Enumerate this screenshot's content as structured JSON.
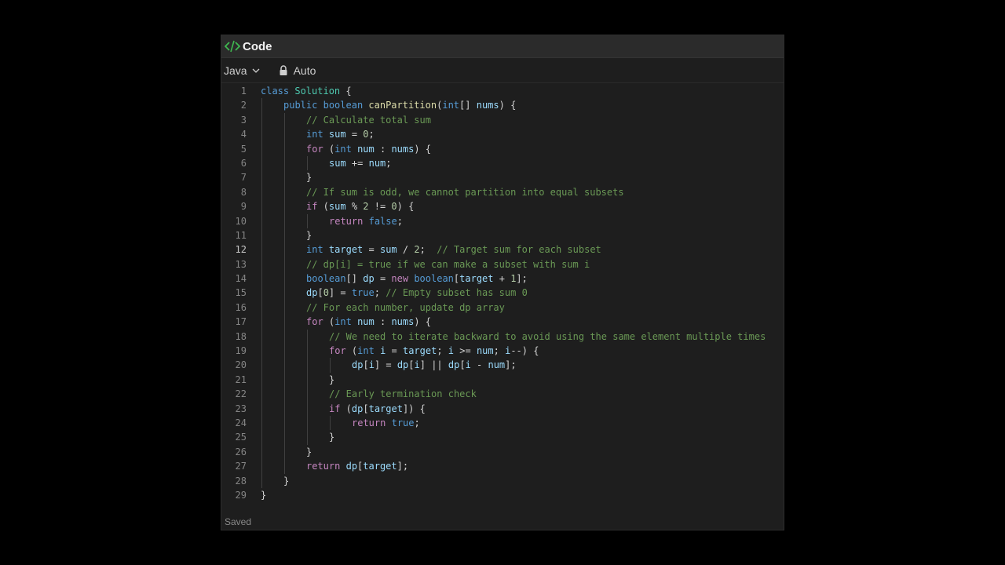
{
  "header": {
    "title": "Code",
    "icon": "code-icon",
    "accent": "#3fb950"
  },
  "toolbar": {
    "language": "Java",
    "mode": "Auto"
  },
  "status": {
    "text": "Saved"
  },
  "active_line": 12,
  "code_lines": [
    {
      "n": "1",
      "indent": 0,
      "tokens": [
        [
          "kw",
          "class"
        ],
        [
          "p",
          " "
        ],
        [
          "ty",
          "Solution"
        ],
        [
          "p",
          " {"
        ]
      ]
    },
    {
      "n": "2",
      "indent": 1,
      "tokens": [
        [
          "kw",
          "public"
        ],
        [
          "p",
          " "
        ],
        [
          "kw",
          "boolean"
        ],
        [
          "p",
          " "
        ],
        [
          "fn",
          "canPartition"
        ],
        [
          "p",
          "("
        ],
        [
          "kw",
          "int"
        ],
        [
          "p",
          "[] "
        ],
        [
          "var",
          "nums"
        ],
        [
          "p",
          ") {"
        ]
      ]
    },
    {
      "n": "3",
      "indent": 2,
      "tokens": [
        [
          "cm",
          "// Calculate total sum"
        ]
      ]
    },
    {
      "n": "4",
      "indent": 2,
      "tokens": [
        [
          "kw",
          "int"
        ],
        [
          "p",
          " "
        ],
        [
          "var",
          "sum"
        ],
        [
          "p",
          " = "
        ],
        [
          "num",
          "0"
        ],
        [
          "p",
          ";"
        ]
      ]
    },
    {
      "n": "5",
      "indent": 2,
      "tokens": [
        [
          "ctl",
          "for"
        ],
        [
          "p",
          " ("
        ],
        [
          "kw",
          "int"
        ],
        [
          "p",
          " "
        ],
        [
          "var",
          "num"
        ],
        [
          "p",
          " : "
        ],
        [
          "var",
          "nums"
        ],
        [
          "p",
          ") {"
        ]
      ]
    },
    {
      "n": "6",
      "indent": 3,
      "tokens": [
        [
          "var",
          "sum"
        ],
        [
          "p",
          " += "
        ],
        [
          "var",
          "num"
        ],
        [
          "p",
          ";"
        ]
      ]
    },
    {
      "n": "7",
      "indent": 2,
      "tokens": [
        [
          "p",
          "}"
        ]
      ]
    },
    {
      "n": "8",
      "indent": 2,
      "tokens": [
        [
          "cm",
          "// If sum is odd, we cannot partition into equal subsets"
        ]
      ]
    },
    {
      "n": "9",
      "indent": 2,
      "tokens": [
        [
          "ctl",
          "if"
        ],
        [
          "p",
          " ("
        ],
        [
          "var",
          "sum"
        ],
        [
          "p",
          " % "
        ],
        [
          "num",
          "2"
        ],
        [
          "p",
          " != "
        ],
        [
          "num",
          "0"
        ],
        [
          "p",
          ") {"
        ]
      ]
    },
    {
      "n": "10",
      "indent": 3,
      "tokens": [
        [
          "ctl",
          "return"
        ],
        [
          "p",
          " "
        ],
        [
          "kw",
          "false"
        ],
        [
          "p",
          ";"
        ]
      ]
    },
    {
      "n": "11",
      "indent": 2,
      "tokens": [
        [
          "p",
          "}"
        ]
      ]
    },
    {
      "n": "12",
      "indent": 2,
      "tokens": [
        [
          "kw",
          "int"
        ],
        [
          "p",
          " "
        ],
        [
          "var",
          "target"
        ],
        [
          "p",
          " = "
        ],
        [
          "var",
          "sum"
        ],
        [
          "p",
          " / "
        ],
        [
          "num",
          "2"
        ],
        [
          "p",
          ";  "
        ],
        [
          "cm",
          "// Target sum for each subset"
        ]
      ]
    },
    {
      "n": "13",
      "indent": 2,
      "tokens": [
        [
          "cm",
          "// dp[i] = true if we can make a subset with sum i"
        ]
      ]
    },
    {
      "n": "14",
      "indent": 2,
      "tokens": [
        [
          "kw",
          "boolean"
        ],
        [
          "p",
          "[] "
        ],
        [
          "var",
          "dp"
        ],
        [
          "p",
          " = "
        ],
        [
          "ctl",
          "new"
        ],
        [
          "p",
          " "
        ],
        [
          "kw",
          "boolean"
        ],
        [
          "p",
          "["
        ],
        [
          "var",
          "target"
        ],
        [
          "p",
          " + "
        ],
        [
          "num",
          "1"
        ],
        [
          "p",
          "];"
        ]
      ]
    },
    {
      "n": "15",
      "indent": 2,
      "tokens": [
        [
          "var",
          "dp"
        ],
        [
          "p",
          "["
        ],
        [
          "num",
          "0"
        ],
        [
          "p",
          "] = "
        ],
        [
          "kw",
          "true"
        ],
        [
          "p",
          "; "
        ],
        [
          "cm",
          "// Empty subset has sum 0"
        ]
      ]
    },
    {
      "n": "16",
      "indent": 2,
      "tokens": [
        [
          "cm",
          "// For each number, update dp array"
        ]
      ]
    },
    {
      "n": "17",
      "indent": 2,
      "tokens": [
        [
          "ctl",
          "for"
        ],
        [
          "p",
          " ("
        ],
        [
          "kw",
          "int"
        ],
        [
          "p",
          " "
        ],
        [
          "var",
          "num"
        ],
        [
          "p",
          " : "
        ],
        [
          "var",
          "nums"
        ],
        [
          "p",
          ") {"
        ]
      ]
    },
    {
      "n": "18",
      "indent": 3,
      "tokens": [
        [
          "cm",
          "// We need to iterate backward to avoid using the same element multiple times"
        ]
      ]
    },
    {
      "n": "19",
      "indent": 3,
      "tokens": [
        [
          "ctl",
          "for"
        ],
        [
          "p",
          " ("
        ],
        [
          "kw",
          "int"
        ],
        [
          "p",
          " "
        ],
        [
          "var",
          "i"
        ],
        [
          "p",
          " = "
        ],
        [
          "var",
          "target"
        ],
        [
          "p",
          "; "
        ],
        [
          "var",
          "i"
        ],
        [
          "p",
          " >= "
        ],
        [
          "var",
          "num"
        ],
        [
          "p",
          "; "
        ],
        [
          "var",
          "i"
        ],
        [
          "p",
          "--) {"
        ]
      ]
    },
    {
      "n": "20",
      "indent": 4,
      "tokens": [
        [
          "var",
          "dp"
        ],
        [
          "p",
          "["
        ],
        [
          "var",
          "i"
        ],
        [
          "p",
          "] = "
        ],
        [
          "var",
          "dp"
        ],
        [
          "p",
          "["
        ],
        [
          "var",
          "i"
        ],
        [
          "p",
          "] || "
        ],
        [
          "var",
          "dp"
        ],
        [
          "p",
          "["
        ],
        [
          "var",
          "i"
        ],
        [
          "p",
          " - "
        ],
        [
          "var",
          "num"
        ],
        [
          "p",
          "];"
        ]
      ]
    },
    {
      "n": "21",
      "indent": 3,
      "tokens": [
        [
          "p",
          "}"
        ]
      ]
    },
    {
      "n": "22",
      "indent": 3,
      "tokens": [
        [
          "cm",
          "// Early termination check"
        ]
      ]
    },
    {
      "n": "23",
      "indent": 3,
      "tokens": [
        [
          "ctl",
          "if"
        ],
        [
          "p",
          " ("
        ],
        [
          "var",
          "dp"
        ],
        [
          "p",
          "["
        ],
        [
          "var",
          "target"
        ],
        [
          "p",
          "]) {"
        ]
      ]
    },
    {
      "n": "24",
      "indent": 4,
      "tokens": [
        [
          "ctl",
          "return"
        ],
        [
          "p",
          " "
        ],
        [
          "kw",
          "true"
        ],
        [
          "p",
          ";"
        ]
      ]
    },
    {
      "n": "25",
      "indent": 3,
      "tokens": [
        [
          "p",
          "}"
        ]
      ]
    },
    {
      "n": "26",
      "indent": 2,
      "tokens": [
        [
          "p",
          "}"
        ]
      ]
    },
    {
      "n": "27",
      "indent": 2,
      "tokens": [
        [
          "ctl",
          "return"
        ],
        [
          "p",
          " "
        ],
        [
          "var",
          "dp"
        ],
        [
          "p",
          "["
        ],
        [
          "var",
          "target"
        ],
        [
          "p",
          "];"
        ]
      ]
    },
    {
      "n": "28",
      "indent": 1,
      "tokens": [
        [
          "p",
          "}"
        ]
      ]
    },
    {
      "n": "29",
      "indent": 0,
      "tokens": [
        [
          "p",
          "}"
        ]
      ]
    }
  ]
}
